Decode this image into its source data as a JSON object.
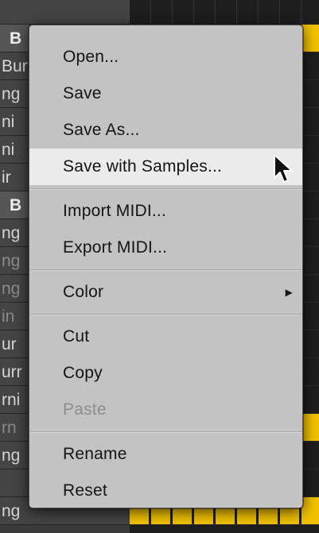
{
  "background": {
    "left_list": [
      {
        "text": "",
        "kind": "plain"
      },
      {
        "text": "B",
        "kind": "group"
      },
      {
        "text": "Bur",
        "kind": "plain"
      },
      {
        "text": "ng",
        "kind": "plain"
      },
      {
        "text": "ni",
        "kind": "plain"
      },
      {
        "text": "ni",
        "kind": "plain"
      },
      {
        "text": "ir",
        "kind": "plain"
      },
      {
        "text": "B",
        "kind": "group"
      },
      {
        "text": "ng",
        "kind": "plain"
      },
      {
        "text": "ng",
        "kind": "dim"
      },
      {
        "text": "ng",
        "kind": "dim"
      },
      {
        "text": "in",
        "kind": "dim"
      },
      {
        "text": "ur",
        "kind": "plain"
      },
      {
        "text": "urr",
        "kind": "plain"
      },
      {
        "text": "rni",
        "kind": "plain"
      },
      {
        "text": "rn",
        "kind": "dim"
      },
      {
        "text": "ng",
        "kind": "plain"
      },
      {
        "text": "",
        "kind": "plain"
      },
      {
        "text": "ng",
        "kind": "plain"
      }
    ],
    "grid_active_rows": [
      1,
      15,
      18
    ],
    "colors": {
      "step_on": "#f2c200"
    }
  },
  "menu": {
    "groups": [
      [
        {
          "label": "Open...",
          "state": "normal"
        },
        {
          "label": "Save",
          "state": "normal"
        },
        {
          "label": "Save As...",
          "state": "normal"
        },
        {
          "label": "Save with Samples...",
          "state": "highlighted"
        }
      ],
      [
        {
          "label": "Import MIDI...",
          "state": "normal"
        },
        {
          "label": "Export MIDI...",
          "state": "normal"
        }
      ],
      [
        {
          "label": "Color",
          "state": "normal",
          "submenu": true
        }
      ],
      [
        {
          "label": "Cut",
          "state": "normal"
        },
        {
          "label": "Copy",
          "state": "normal"
        },
        {
          "label": "Paste",
          "state": "disabled"
        }
      ],
      [
        {
          "label": "Rename",
          "state": "normal"
        },
        {
          "label": "Reset",
          "state": "normal"
        }
      ]
    ],
    "submenu_icon": "triangle-right-icon"
  },
  "cursor_icon": "arrow-pointer-icon"
}
